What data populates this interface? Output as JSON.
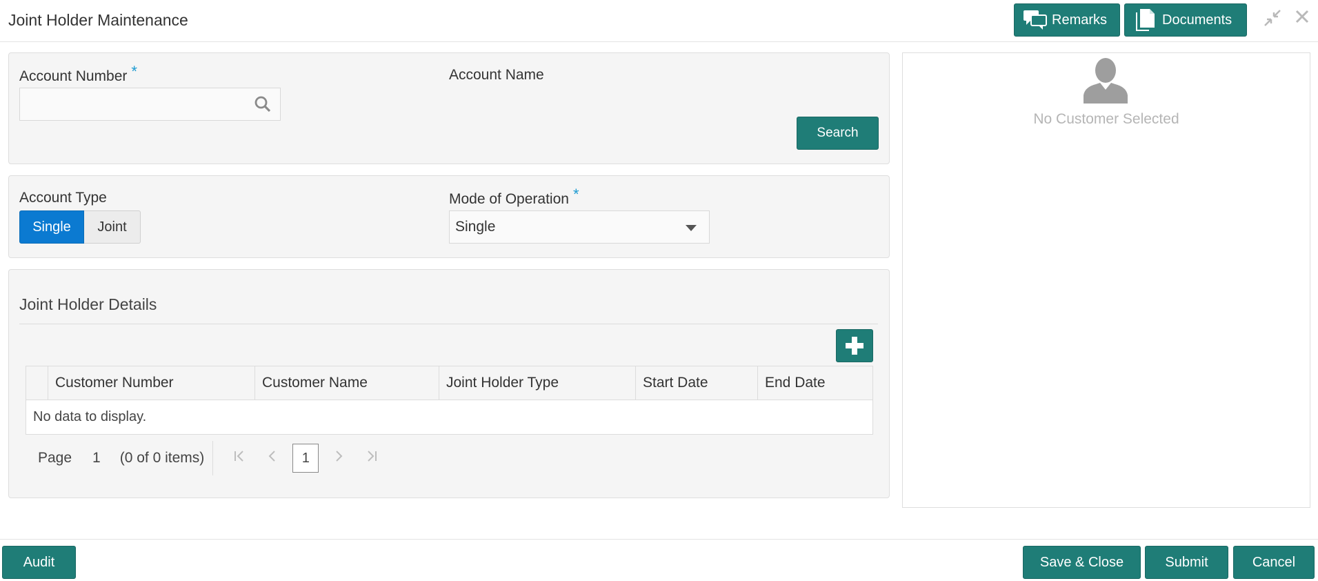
{
  "header": {
    "title": "Joint Holder Maintenance",
    "remarks_label": "Remarks",
    "documents_label": "Documents"
  },
  "search_panel": {
    "account_number_label": "Account Number",
    "required_mark": "*",
    "account_name_label": "Account Name",
    "search_label": "Search",
    "account_number_value": ""
  },
  "type_panel": {
    "account_type_label": "Account Type",
    "options": [
      "Single",
      "Joint"
    ],
    "selected": "Single",
    "mode_label": "Mode of Operation",
    "mode_value": "Single"
  },
  "details": {
    "section_title": "Joint Holder Details",
    "columns": [
      "Customer Number",
      "Customer Name",
      "Joint Holder Type",
      "Start Date",
      "End Date"
    ],
    "empty_text": "No data to display.",
    "pager": {
      "page_label": "Page",
      "page_number": "1",
      "items_text": "(0 of 0 items)",
      "current_page": "1"
    }
  },
  "customer_card": {
    "empty_text": "No Customer Selected"
  },
  "footer": {
    "audit_label": "Audit",
    "save_close_label": "Save & Close",
    "submit_label": "Submit",
    "cancel_label": "Cancel"
  },
  "colors": {
    "teal": "#1f7d77",
    "active_blue": "#0b7ad1",
    "required": "#1d9bd1"
  }
}
